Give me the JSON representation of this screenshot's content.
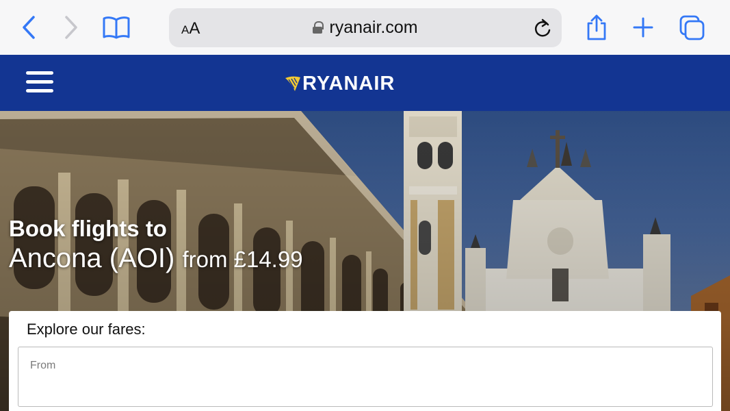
{
  "browser": {
    "text_size_button": "AA",
    "url": "ryanair.com",
    "icons": [
      "back-icon",
      "forward-icon",
      "bookmarks-icon",
      "lock-icon",
      "reload-icon",
      "share-icon",
      "new-tab-icon",
      "tabs-icon"
    ],
    "accent_color": "#1a73e8"
  },
  "header": {
    "logo_text": "RYANAIR",
    "brand_color": "#133592",
    "logo_accent": "#f1c933"
  },
  "hero": {
    "title": "Book flights to",
    "destination": "Ancona (AOI)",
    "price_text": "from £14.99"
  },
  "fares": {
    "heading": "Explore our fares:",
    "from_label": "From"
  }
}
